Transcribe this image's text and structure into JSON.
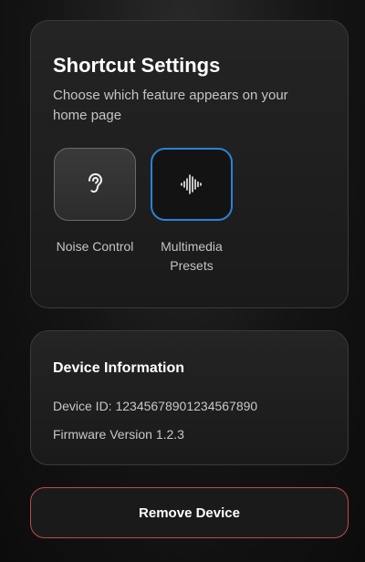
{
  "shortcut_settings": {
    "title": "Shortcut Settings",
    "subtitle": "Choose which feature appears on your home page",
    "options": [
      {
        "label": "Noise Control",
        "icon": "ear-icon",
        "selected": false
      },
      {
        "label": "Multimedia Presets",
        "icon": "sound-wave-icon",
        "selected": true
      }
    ]
  },
  "device_information": {
    "title": "Device Information",
    "device_id_label": "Device ID:",
    "device_id": "12345678901234567890",
    "firmware_label": "Firmware Version",
    "firmware_version": "1.2.3"
  },
  "remove_button": {
    "label": "Remove Device"
  },
  "colors": {
    "accent": "#2a82d8",
    "danger_border": "#c04a4a",
    "background": "#141414"
  }
}
